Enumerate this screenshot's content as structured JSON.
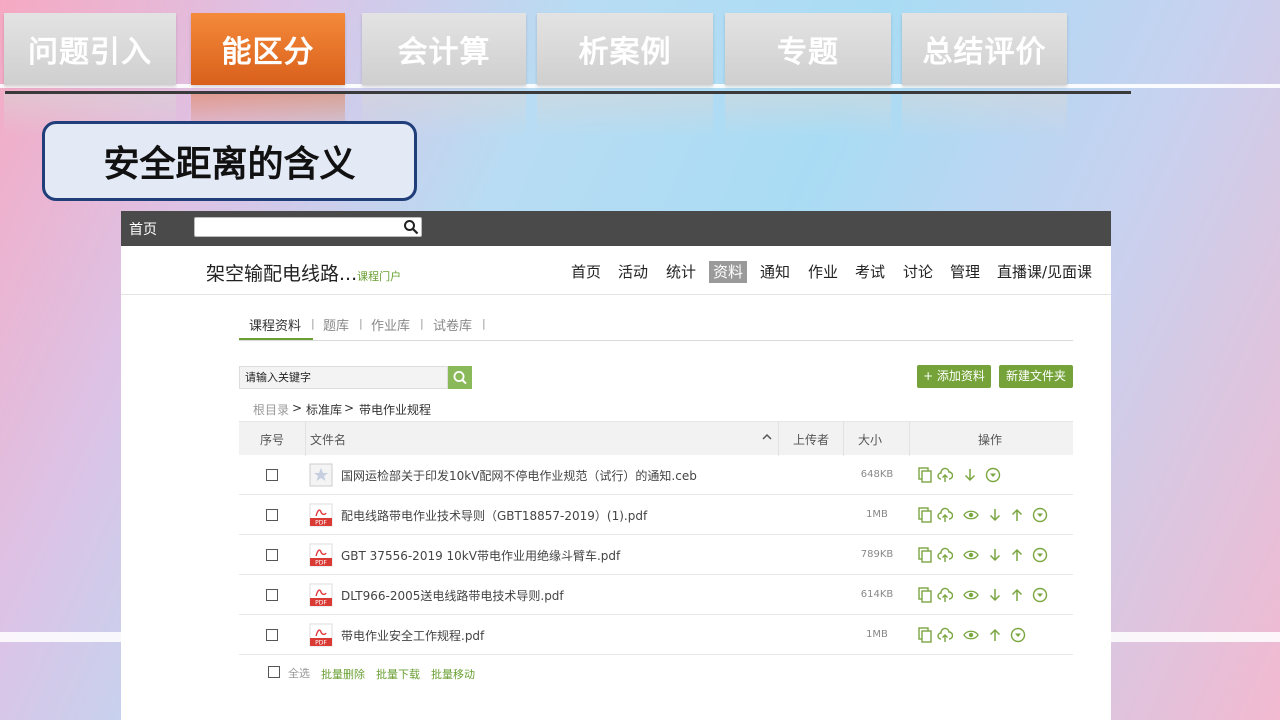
{
  "slide": {
    "tabs": [
      {
        "label": "问题引入",
        "active": false
      },
      {
        "label": "能区分",
        "active": true
      },
      {
        "label": "会计算",
        "active": false
      },
      {
        "label": "析案例",
        "active": false
      },
      {
        "label": "专题",
        "active": false
      },
      {
        "label": "总结评价",
        "active": false
      }
    ],
    "title": "安全距离的含义"
  },
  "portal": {
    "topbar_home": "首页",
    "search_icon": "search-icon",
    "course_title": "架空输配电线路...",
    "course_subtitle": "课程门户",
    "nav": [
      "首页",
      "活动",
      "统计",
      "资料",
      "通知",
      "作业",
      "考试",
      "讨论",
      "管理",
      "直播课/见面课"
    ],
    "nav_active": "资料",
    "sub_tabs": [
      "课程资料",
      "题库",
      "作业库",
      "试卷库"
    ],
    "sub_sep": "|",
    "keyword_placeholder": "请输入关键字",
    "add_button": "+ 添加资料",
    "new_folder_button": "新建文件夹",
    "breadcrumb": [
      "根目录",
      "标准库",
      "带电作业规程"
    ],
    "breadcrumb_sep": ">",
    "table_headers": {
      "index": "序号",
      "name": "文件名",
      "uploader": "上传者",
      "size": "大小",
      "actions": "操作"
    },
    "files": [
      {
        "icon": "star-file-icon",
        "name": "国网运检部关于印发10kV配网不停电作业规范（试行）的通知.ceb",
        "size": "648KB",
        "actions": [
          "copy-icon",
          "cloud-upload-icon",
          "download-icon",
          "more-icon"
        ]
      },
      {
        "icon": "pdf-icon",
        "name": "配电线路带电作业技术导则（GBT18857-2019）(1).pdf",
        "size": "1MB",
        "actions": [
          "copy-icon",
          "cloud-upload-icon",
          "eye-icon",
          "download-icon",
          "upload-icon",
          "more-icon"
        ]
      },
      {
        "icon": "pdf-icon",
        "name": "GBT 37556-2019 10kV带电作业用绝缘斗臂车.pdf",
        "size": "789KB",
        "actions": [
          "copy-icon",
          "cloud-upload-icon",
          "eye-icon",
          "download-icon",
          "upload-icon",
          "more-icon"
        ]
      },
      {
        "icon": "pdf-icon",
        "name": "DLT966-2005送电线路带电技术导则.pdf",
        "size": "614KB",
        "actions": [
          "copy-icon",
          "cloud-upload-icon",
          "eye-icon",
          "download-icon",
          "upload-icon",
          "more-icon"
        ]
      },
      {
        "icon": "pdf-icon",
        "name": "带电作业安全工作规程.pdf",
        "size": "1MB",
        "actions": [
          "copy-icon",
          "cloud-upload-icon",
          "eye-icon",
          "upload-icon",
          "more-icon"
        ]
      }
    ],
    "footer": {
      "select_all": "全选",
      "batch_delete": "批量删除",
      "batch_download": "批量下载",
      "batch_move": "批量移动"
    },
    "pdf_badge": "PDF",
    "colors": {
      "accent_green": "#75a33a",
      "tab_active": "#e2702a",
      "topbar": "#4a4a4a"
    }
  }
}
